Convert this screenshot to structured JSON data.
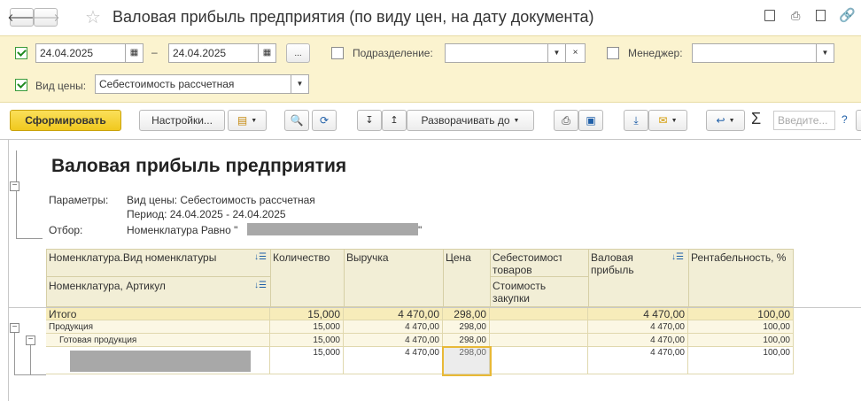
{
  "window": {
    "title": "Валовая прибыль предприятия (по виду цен, на дату документа)"
  },
  "filters": {
    "date_from": "24.04.2025",
    "date_to": "24.04.2025",
    "dash": "–",
    "more": "...",
    "division_label": "Подразделение:",
    "division_value": "",
    "manager_label": "Менеджер:",
    "manager_value": "",
    "price_type_label": "Вид цены:",
    "price_type_value": "Себестоимость рассчетная"
  },
  "toolbar": {
    "generate": "Сформировать",
    "settings": "Настройки...",
    "expand_to": "Разворачивать до",
    "search_placeholder": "Введите...",
    "help": "?",
    "sigma": "Σ"
  },
  "report": {
    "title": "Валовая прибыль предприятия",
    "params_label": "Параметры:",
    "params_line1": "Вид цены: Себестоимость рассчетная",
    "params_line2": "Период: 24.04.2025 - 24.04.2025",
    "filter_label": "Отбор:",
    "filter_prefix": "Номенклатура Равно \"",
    "filter_suffix": "\""
  },
  "table": {
    "headers": {
      "group1": "Номенклатура.Вид номенклатуры",
      "group2": "Номенклатура, Артикул",
      "qty": "Количество",
      "revenue": "Выручка",
      "price": "Цена",
      "cost1": "Себестоимость товаров",
      "cost2": "Стоимость закупки",
      "profit": "Валовая прибыль",
      "margin": "Рентабельность, %"
    },
    "rows": [
      {
        "label": "Итого",
        "qty": "15,000",
        "revenue": "4 470,00",
        "price": "298,00",
        "cost": "",
        "profit": "4 470,00",
        "margin": "100,00"
      },
      {
        "label": "Продукция",
        "qty": "15,000",
        "revenue": "4 470,00",
        "price": "298,00",
        "cost": "",
        "profit": "4 470,00",
        "margin": "100,00"
      },
      {
        "label": "Готовая продукция",
        "qty": "15,000",
        "revenue": "4 470,00",
        "price": "298,00",
        "cost": "",
        "profit": "4 470,00",
        "margin": "100,00"
      },
      {
        "label": "",
        "qty": "15,000",
        "revenue": "4 470,00",
        "price": "298,00",
        "cost": "",
        "profit": "4 470,00",
        "margin": "100,00"
      }
    ]
  },
  "colors": {
    "accent_yellow": "#f5d234",
    "header_fill": "#f2eed6",
    "total_fill": "#f7ecba",
    "row_fill": "#fbf7e4",
    "filter_bar": "#fbf3cf",
    "checkbox_green": "#1f8a1f",
    "selection": "#e8b937"
  }
}
